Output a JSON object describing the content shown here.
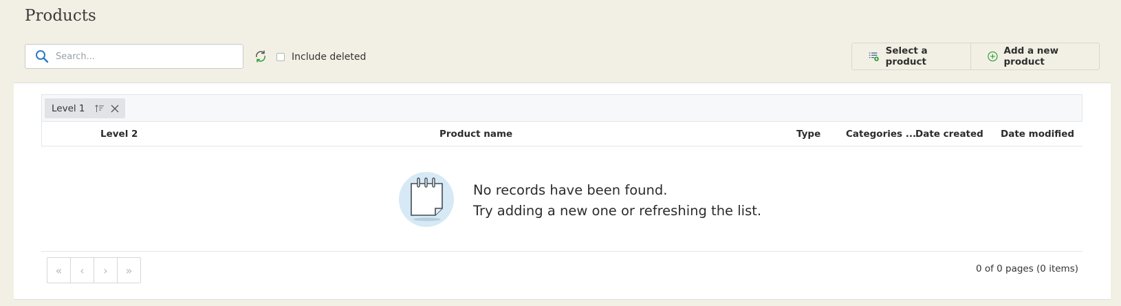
{
  "page": {
    "title": "Products"
  },
  "toolbar": {
    "search_placeholder": "Search...",
    "include_deleted_label": "Include deleted",
    "include_deleted_checked": false,
    "select_product_label": "Select a product",
    "add_product_label": "Add a new product"
  },
  "grid": {
    "group_chip": "Level 1",
    "columns": [
      "Level 2",
      "Product name",
      "Type",
      "Categories ...",
      "Date created",
      "Date modified"
    ],
    "empty_line1": "No records have been found.",
    "empty_line2": "Try adding a new one or refreshing the list."
  },
  "pager": {
    "first": "«",
    "prev": "‹",
    "next": "›",
    "last": "»",
    "info": "0 of 0 pages (0 items)"
  },
  "colors": {
    "background": "#f2f0e4",
    "accent_green": "#2e9e3a",
    "empty_icon_circle": "#d6e9f4"
  }
}
